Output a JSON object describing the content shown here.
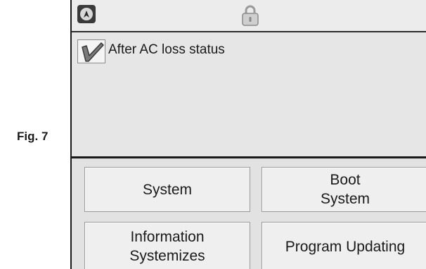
{
  "figure": {
    "label": "Fig. 7"
  },
  "topbar": {
    "nav_icon": "navigation-compass-icon",
    "lock_icon": "lock-icon"
  },
  "content": {
    "checkbox": {
      "checked": true,
      "label": "After AC loss status"
    }
  },
  "buttons": {
    "system": {
      "label": "System"
    },
    "boot_system": {
      "line1": "Boot",
      "line2": "System"
    },
    "information": {
      "line1": "Information",
      "line2": "Systemizes"
    },
    "program_updating": {
      "label": "Program Updating"
    }
  }
}
